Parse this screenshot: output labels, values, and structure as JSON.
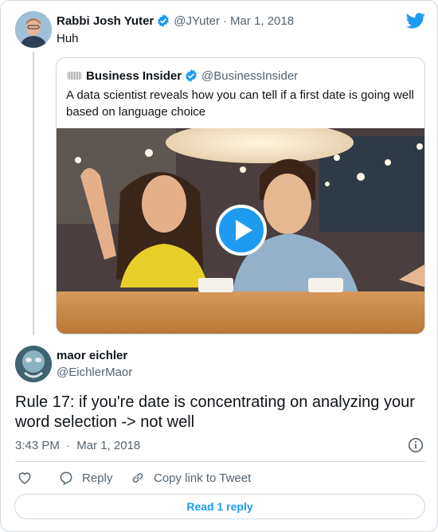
{
  "parent": {
    "name": "Rabbi Josh Yuter",
    "handle": "@JYuter",
    "separator": "·",
    "date": "Mar 1, 2018",
    "text": "Huh"
  },
  "quote": {
    "name": "Business Insider",
    "handle": "@BusinessInsider",
    "text": "A data scientist reveals how you can tell if a first date is going well based on language choice"
  },
  "reply": {
    "name": "maor eichler",
    "handle": "@EichlerMaor",
    "text": "Rule 17: if you're date is concentrating on analyzing your word selection -> not well",
    "time": "3:43 PM",
    "separator": "·",
    "date": "Mar 1, 2018"
  },
  "actions": {
    "reply_label": "Reply",
    "copy_label": "Copy link to Tweet"
  },
  "read_button": "Read 1 reply",
  "colors": {
    "accent": "#1d9bf0",
    "muted": "#536471",
    "border": "#cfd9de",
    "text": "#0f1419"
  },
  "icons": [
    "twitter-bird-icon",
    "verified-badge-icon",
    "play-icon",
    "info-icon",
    "heart-icon",
    "reply-icon",
    "link-icon"
  ]
}
